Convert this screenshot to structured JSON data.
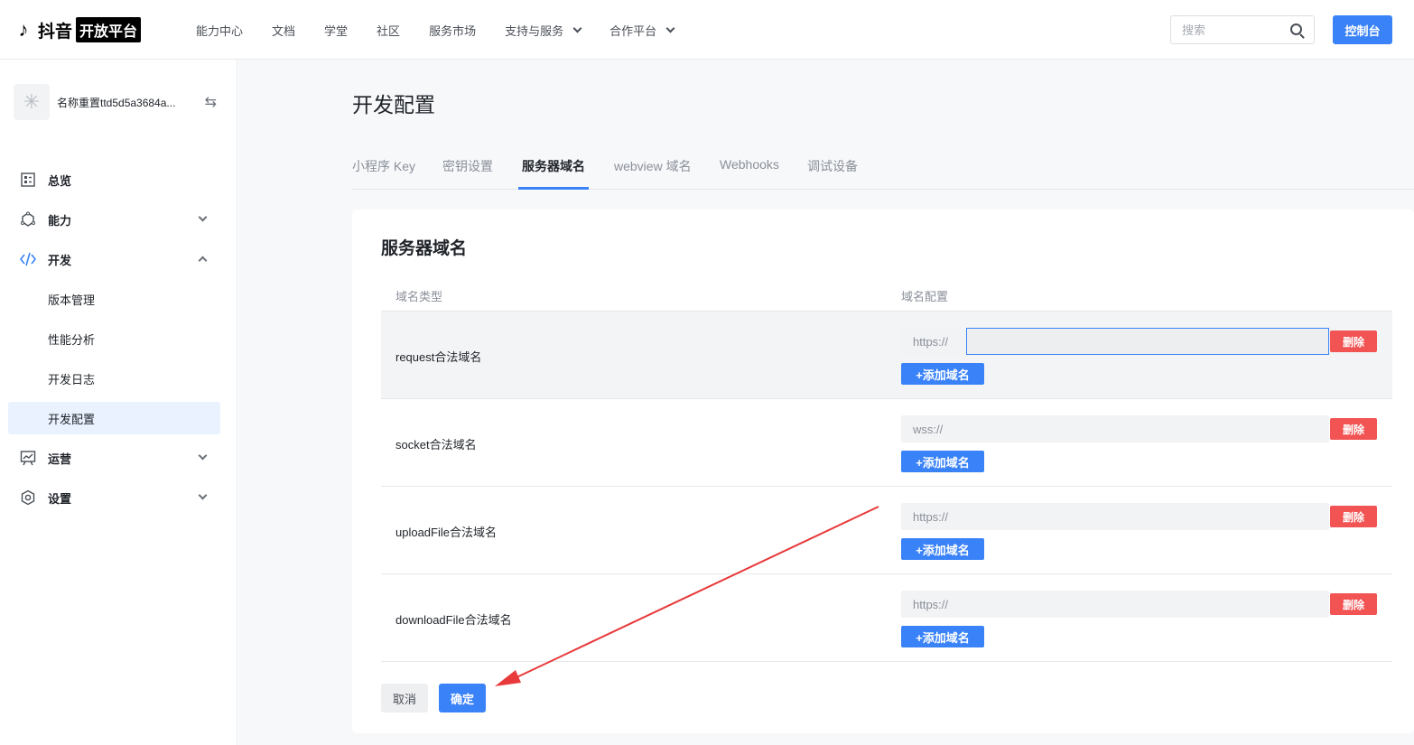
{
  "brand": {
    "icon": "douyin-note-icon",
    "name": "抖音",
    "tag": "开放平台"
  },
  "nav": {
    "items": [
      "能力中心",
      "文档",
      "学堂",
      "社区",
      "服务市场"
    ],
    "dropdowns": [
      "支持与服务",
      "合作平台"
    ],
    "search_placeholder": "搜索",
    "console_label": "控制台"
  },
  "sidebar": {
    "app_name": "名称重置ttd5d5a3684a...",
    "menu": {
      "overview": "总览",
      "ability": "能力",
      "develop": "开发",
      "operations": "运营",
      "settings": "设置"
    },
    "develop_sub": [
      "版本管理",
      "性能分析",
      "开发日志",
      "开发配置"
    ],
    "active_sub": "开发配置"
  },
  "main": {
    "page_title": "开发配置",
    "tabs": [
      "小程序 Key",
      "密钥设置",
      "服务器域名",
      "webview 域名",
      "Webhooks",
      "调试设备"
    ],
    "active_tab": "服务器域名",
    "card_title": "服务器域名",
    "col_type": "域名类型",
    "col_config": "域名配置",
    "rows": [
      {
        "label": "request合法域名",
        "prefix": "https://",
        "value": ""
      },
      {
        "label": "socket合法域名",
        "prefix": "wss://",
        "value": ""
      },
      {
        "label": "uploadFile合法域名",
        "prefix": "https://",
        "value": ""
      },
      {
        "label": "downloadFile合法域名",
        "prefix": "https://",
        "value": ""
      }
    ],
    "delete_label": "删除",
    "add_label": "+添加域名",
    "cancel_label": "取消",
    "ok_label": "确定"
  },
  "colors": {
    "accent": "#3a82f7",
    "danger": "#f25353",
    "annotation": "#e8393b"
  }
}
